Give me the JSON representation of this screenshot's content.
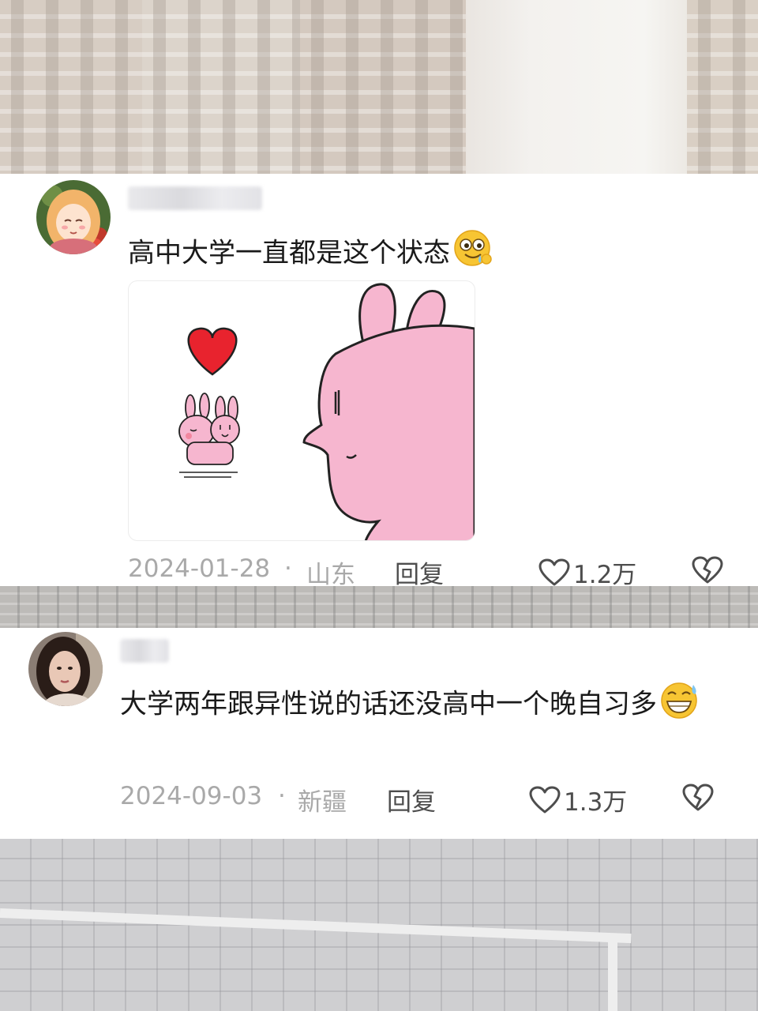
{
  "comments": [
    {
      "text": "高中大学一直都是这个状态",
      "emoji": "drooling-face",
      "has_sticker": true,
      "date": "2024-01-28",
      "separator": "·",
      "region": "山东",
      "reply_label": "回复",
      "like_count": "1.2万"
    },
    {
      "text": "大学两年跟异性说的话还没高中一个晚自习多",
      "emoji": "grinning-sweat-face",
      "has_sticker": false,
      "date": "2024-09-03",
      "separator": "·",
      "region": "新疆",
      "reply_label": "回复",
      "like_count": "1.3万"
    }
  ],
  "colors": {
    "card_background": "#ffffff",
    "text": "#1a1a1a",
    "meta_text": "#a9a9a9",
    "action_text": "#4d4d4d",
    "sticker_pink": "#f6b6cf",
    "heart_red": "#e8232e"
  },
  "icons": {
    "like": "heart-outline-icon",
    "dislike": "broken-heart-icon"
  }
}
